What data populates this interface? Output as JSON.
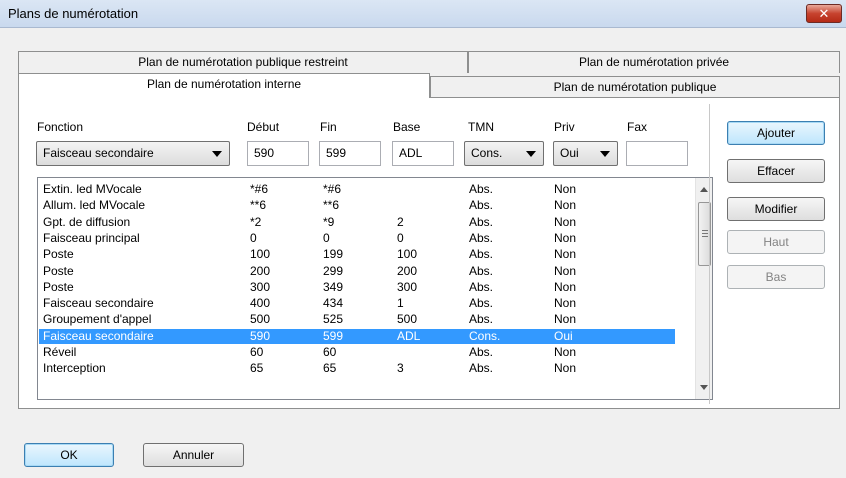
{
  "window": {
    "title": "Plans de numérotation",
    "close_label": "✕"
  },
  "tabs": [
    {
      "label": "Plan de numérotation publique restreint"
    },
    {
      "label": "Plan de numérotation privée"
    },
    {
      "label": "Plan de numérotation interne"
    },
    {
      "label": "Plan de numérotation publique"
    }
  ],
  "form": {
    "labels": {
      "fonction": "Fonction",
      "debut": "Début",
      "fin": "Fin",
      "base": "Base",
      "tmn": "TMN",
      "priv": "Priv",
      "fax": "Fax"
    },
    "fonction_value": "Faisceau secondaire",
    "debut_value": "590",
    "fin_value": "599",
    "base_value": "ADL",
    "tmn_value": "Cons.",
    "priv_value": "Oui",
    "fax_value": ""
  },
  "list": {
    "rows": [
      {
        "fonction": "Extin. led MVocale",
        "debut": "*#6",
        "fin": "*#6",
        "base": "",
        "tmn": "Abs.",
        "priv": "Non"
      },
      {
        "fonction": "Allum. led MVocale",
        "debut": "**6",
        "fin": "**6",
        "base": "",
        "tmn": "Abs.",
        "priv": "Non"
      },
      {
        "fonction": "Gpt. de diffusion",
        "debut": "*2",
        "fin": "*9",
        "base": "2",
        "tmn": "Abs.",
        "priv": "Non"
      },
      {
        "fonction": "Faisceau principal",
        "debut": "0",
        "fin": "0",
        "base": "0",
        "tmn": "Abs.",
        "priv": "Non"
      },
      {
        "fonction": "Poste",
        "debut": "100",
        "fin": "199",
        "base": "100",
        "tmn": "Abs.",
        "priv": "Non"
      },
      {
        "fonction": "Poste",
        "debut": "200",
        "fin": "299",
        "base": "200",
        "tmn": "Abs.",
        "priv": "Non"
      },
      {
        "fonction": "Poste",
        "debut": "300",
        "fin": "349",
        "base": "300",
        "tmn": "Abs.",
        "priv": "Non"
      },
      {
        "fonction": "Faisceau secondaire",
        "debut": "400",
        "fin": "434",
        "base": "1",
        "tmn": "Abs.",
        "priv": "Non"
      },
      {
        "fonction": "Groupement d'appel",
        "debut": "500",
        "fin": "525",
        "base": "500",
        "tmn": "Abs.",
        "priv": "Non"
      },
      {
        "fonction": "Faisceau secondaire",
        "debut": "590",
        "fin": "599",
        "base": "ADL",
        "tmn": "Cons.",
        "priv": "Oui"
      },
      {
        "fonction": "Réveil",
        "debut": "60",
        "fin": "60",
        "base": "",
        "tmn": "Abs.",
        "priv": "Non"
      },
      {
        "fonction": "Interception",
        "debut": "65",
        "fin": "65",
        "base": "3",
        "tmn": "Abs.",
        "priv": "Non"
      }
    ],
    "selected_index": 9
  },
  "side_buttons": {
    "ajouter": "Ajouter",
    "effacer": "Effacer",
    "modifier": "Modifier",
    "haut": "Haut",
    "bas": "Bas"
  },
  "footer": {
    "ok": "OK",
    "annuler": "Annuler"
  },
  "colors": {
    "selection": "#3399ff",
    "close_button": "#c7432f"
  }
}
